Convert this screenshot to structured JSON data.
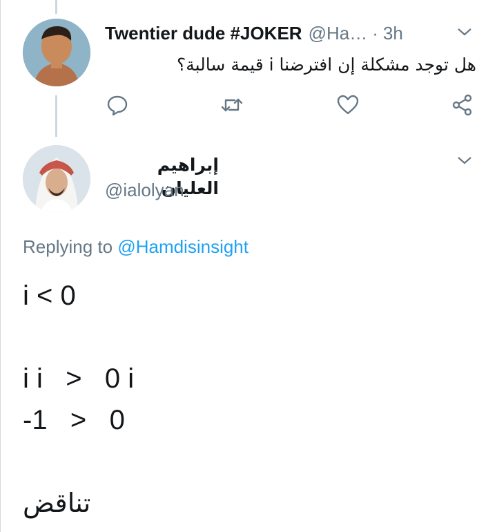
{
  "tweet1": {
    "name": "Twentier dude #JOKER",
    "handle": "@Ha…",
    "separator": "·",
    "time": "3h",
    "text": "هل توجد مشكلة إن افترضنا i قيمة سالبة؟"
  },
  "tweet2": {
    "name": "إبراهيم العليان",
    "handle": "@ialolyan",
    "replying_prefix": "Replying to",
    "replying_to": "@Hamdisinsight",
    "lines": [
      "i < 0",
      "i i   >   0 i",
      "-1   >   0",
      "تناقض"
    ]
  },
  "icons": {
    "reply": "reply-icon",
    "retweet": "retweet-icon",
    "like": "heart-icon",
    "share": "share-icon",
    "more": "chevron-down-icon"
  },
  "colors": {
    "text": "#14171a",
    "secondary": "#657786",
    "link": "#1da1f2",
    "thread_line": "#ccd6dd"
  }
}
